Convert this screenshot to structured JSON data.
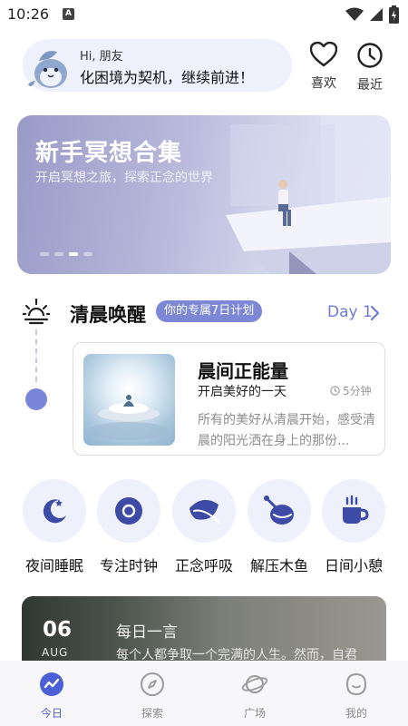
{
  "status_bar": {
    "time": "10:26",
    "notification_badge": "A"
  },
  "greeting": {
    "hello": "Hi, 朋友",
    "motto": "化困境为契机，继续前进！"
  },
  "top_actions": {
    "favorites_label": "喜欢",
    "recent_label": "最近"
  },
  "banner": {
    "title": "新手冥想合集",
    "subtitle": "开启冥想之旅，探索正念的世界",
    "slide_count": 4,
    "active_slide": 3
  },
  "morning": {
    "title": "清晨唤醒",
    "plan_badge": "你的专属7日计划",
    "day_label": "Day 1",
    "session": {
      "title": "晨间正能量",
      "subtitle": "开启美好的一天",
      "duration": "5分钟",
      "description": "所有的美好从清晨开始，感受清晨的阳光洒在身上的那份..."
    }
  },
  "categories": [
    {
      "label": "夜间睡眠",
      "icon": "moon-star-icon"
    },
    {
      "label": "专注时钟",
      "icon": "focus-target-icon"
    },
    {
      "label": "正念呼吸",
      "icon": "leaf-icon"
    },
    {
      "label": "解压木鱼",
      "icon": "wooden-fish-icon"
    },
    {
      "label": "日间小憩",
      "icon": "coffee-cup-icon"
    }
  ],
  "daily_quote": {
    "day": "06",
    "month": "AUG",
    "heading": "每日一言",
    "text": "每个人都争取一个完满的人生。然而，自君"
  },
  "bottom_nav": [
    {
      "label": "今日",
      "active": true
    },
    {
      "label": "探索",
      "active": false
    },
    {
      "label": "广场",
      "active": false
    },
    {
      "label": "我的",
      "active": false
    }
  ],
  "colors": {
    "accent": "#7c87d6",
    "nav_active": "#4c5fd6",
    "icon_tint": "#3d4aa6",
    "soft_bg": "#eef0fb"
  }
}
